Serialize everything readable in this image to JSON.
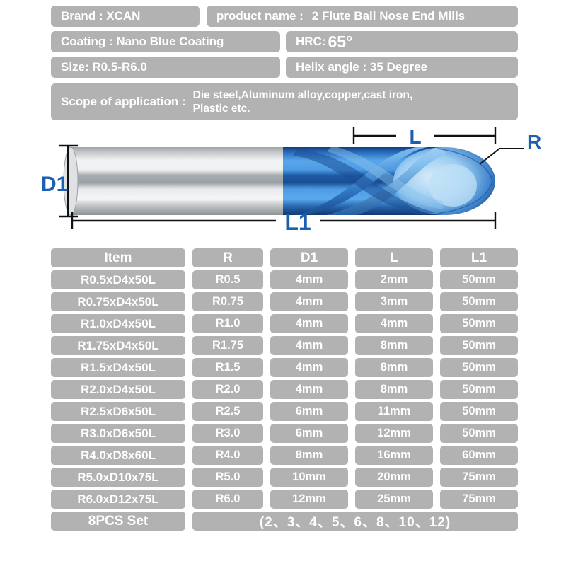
{
  "spec": {
    "rows": [
      [
        {
          "label": "Brand : XCAN",
          "value": ""
        },
        {
          "label": "product name :",
          "value": "2 Flute Ball Nose End Mills"
        }
      ],
      [
        {
          "label": "Coating : Nano Blue Coating",
          "value": ""
        },
        {
          "label": "HRC:",
          "value": "65°"
        }
      ],
      [
        {
          "label": "Size: R0.5-R6.0",
          "value": ""
        },
        {
          "label": "Helix angle : 35 Degree",
          "value": ""
        }
      ]
    ],
    "scope": {
      "label": "Scope of application :",
      "line1": "Die steel,Aluminum alloy,copper,cast iron,",
      "line2": "Plastic etc."
    }
  },
  "diagram": {
    "labels": {
      "d1": "D1",
      "l": "L",
      "l1": "L1",
      "r": "R"
    },
    "colors": {
      "dimension_text": "#1a5fb4",
      "dimension_line": "#111111",
      "coating": "#2f7fd0",
      "shank": "#c9ccce"
    }
  },
  "table": {
    "headers": [
      "Item",
      "R",
      "D1",
      "L",
      "L1"
    ],
    "rows": [
      [
        "R0.5xD4x50L",
        "R0.5",
        "4mm",
        "2mm",
        "50mm"
      ],
      [
        "R0.75xD4x50L",
        "R0.75",
        "4mm",
        "3mm",
        "50mm"
      ],
      [
        "R1.0xD4x50L",
        "R1.0",
        "4mm",
        "4mm",
        "50mm"
      ],
      [
        "R1.75xD4x50L",
        "R1.75",
        "4mm",
        "8mm",
        "50mm"
      ],
      [
        "R1.5xD4x50L",
        "R1.5",
        "4mm",
        "8mm",
        "50mm"
      ],
      [
        "R2.0xD4x50L",
        "R2.0",
        "4mm",
        "8mm",
        "50mm"
      ],
      [
        "R2.5xD6x50L",
        "R2.5",
        "6mm",
        "11mm",
        "50mm"
      ],
      [
        "R3.0xD6x50L",
        "R3.0",
        "6mm",
        "12mm",
        "50mm"
      ],
      [
        "R4.0xD8x60L",
        "R4.0",
        "8mm",
        "16mm",
        "60mm"
      ],
      [
        "R5.0xD10x75L",
        "R5.0",
        "10mm",
        "20mm",
        "75mm"
      ],
      [
        "R6.0xD12x75L",
        "R6.0",
        "12mm",
        "25mm",
        "75mm"
      ]
    ],
    "set_row": {
      "label": "8PCS Set",
      "values": "(2、3、4、5、6、8、10、12)"
    }
  }
}
